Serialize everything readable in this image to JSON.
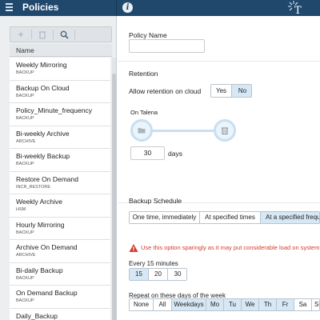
{
  "header": {
    "title": "Policies",
    "menu_icon": "hamburger-menu-icon",
    "info_icon": "info-icon",
    "logo_icon": "talena-logo-icon",
    "colors": {
      "bar": "#20486d",
      "accent": "#d6e8f5"
    }
  },
  "sidebar": {
    "toolbar": {
      "add": "+",
      "delete_icon": "trash-icon",
      "search_icon": "search-icon"
    },
    "column_header": "Name",
    "items": [
      {
        "name": "Weekly Mirroring",
        "type": "BACKUP"
      },
      {
        "name": "Backup On Cloud",
        "type": "BACKUP"
      },
      {
        "name": "Policy_Minute_frequency",
        "type": "BACKUP"
      },
      {
        "name": "Bi-weekly Archive",
        "type": "ARCHIVE"
      },
      {
        "name": "Bi-weekly Backup",
        "type": "BACKUP"
      },
      {
        "name": "Restore On Demand",
        "type": "INCR_RESTORE"
      },
      {
        "name": "Weekly Archive",
        "type": "HSM"
      },
      {
        "name": "Hourly Mirroring",
        "type": "BACKUP"
      },
      {
        "name": "Archive On Demand",
        "type": "ARCHIVE"
      },
      {
        "name": "Bi-daily Backup",
        "type": "BACKUP"
      },
      {
        "name": "On Demand Backup",
        "type": "BACKUP"
      },
      {
        "name": "Daily_Backup",
        "type": ""
      }
    ]
  },
  "form": {
    "policy_name_label": "Policy Name",
    "policy_name_value": "",
    "retention_title": "Retention",
    "allow_retention_label": "Allow retention on cloud",
    "yes": "Yes",
    "no": "No",
    "on_talena": "On Talena",
    "days_value": "30",
    "days_label": "days",
    "schedule_title": "Backup Schedule",
    "schedule_options": [
      "One time, immediately",
      "At specified times",
      "At a specified frequency"
    ],
    "warning": "Use this option sparingly as it may put considerable load on system",
    "every_label": "Every 15 minutes",
    "minutes": [
      "15",
      "20",
      "30"
    ],
    "days_of_week_label": "Repeat on these days of the week",
    "days_presets": [
      "None",
      "All",
      "Weekdays"
    ],
    "days": [
      "Mo",
      "Tu",
      "We",
      "Th",
      "Fr",
      "Sa",
      "Su"
    ]
  }
}
